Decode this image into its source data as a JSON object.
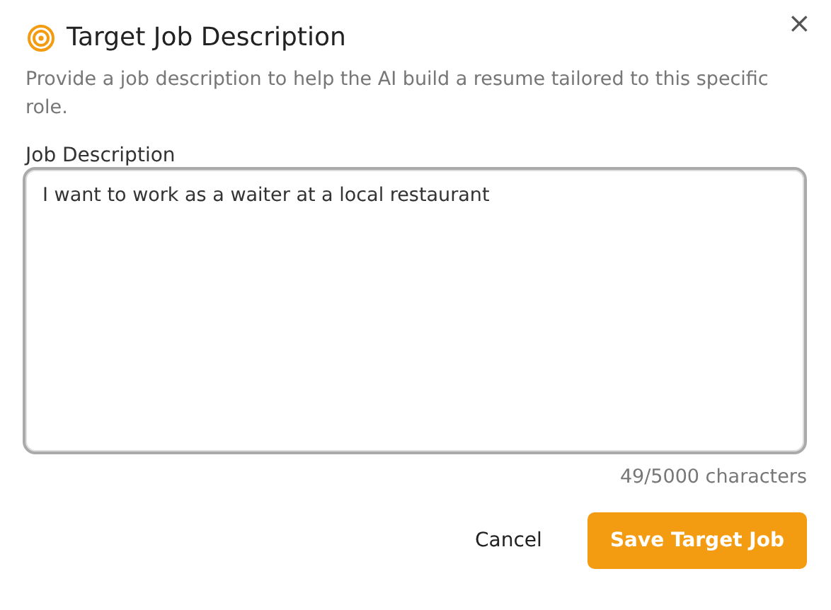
{
  "dialog": {
    "title": "Target Job Description",
    "description": "Provide a job description to help the AI build a resume tailored to this specific role.",
    "close": "×"
  },
  "field": {
    "label": "Job Description",
    "value": "I want to work as a waiter at a local restaurant",
    "counter": "49/5000 characters"
  },
  "buttons": [
    {
      "label": "Cancel",
      "kind": "secondary"
    },
    {
      "label": "Save Target Job",
      "kind": "primary"
    }
  ]
}
